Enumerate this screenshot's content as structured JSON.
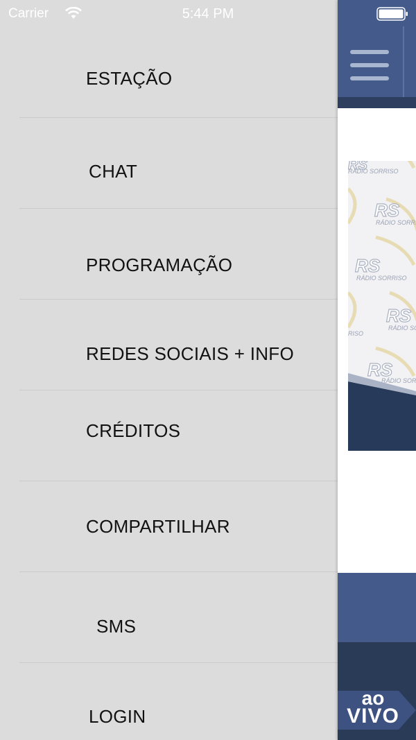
{
  "status_bar": {
    "carrier": "Carrier",
    "time": "5:44 PM",
    "wifi_icon": "wifi-icon",
    "battery_icon": "battery-icon"
  },
  "menu": {
    "items": [
      {
        "label": "ESTAÇÃO"
      },
      {
        "label": "CHAT"
      },
      {
        "label": "PROGRAMAÇÃO"
      },
      {
        "label": "REDES SOCIAIS + INFO"
      },
      {
        "label": "CRÉDITOS"
      },
      {
        "label": "COMPARTILHAR"
      },
      {
        "label": "SMS"
      },
      {
        "label": "LOGIN"
      }
    ]
  },
  "main_view": {
    "menu_icon": "hamburger-icon",
    "banner_logo_text": "RS",
    "banner_caption": "RÁDIO SORRISO",
    "live_badge": {
      "line1": "ao",
      "line2": "VIVO"
    }
  },
  "colors": {
    "drawer_background": "#dcdcdc",
    "header_blue": "#435a8a",
    "dark_navy": "#2a3b57",
    "menu_text": "#111111"
  }
}
